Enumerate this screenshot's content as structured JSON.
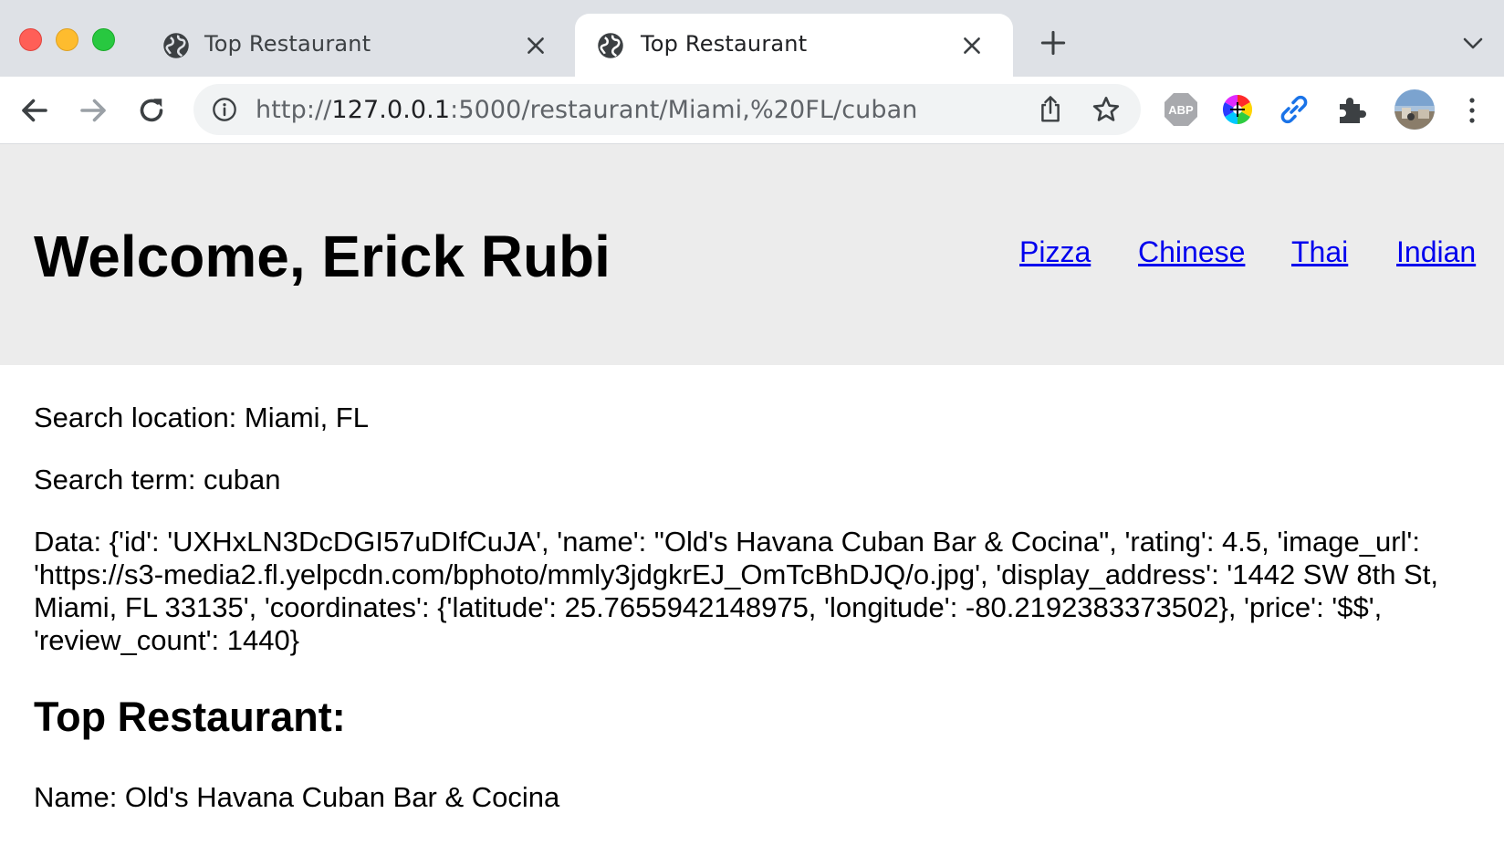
{
  "browser": {
    "tabs": [
      {
        "title": "Top Restaurant",
        "active": false
      },
      {
        "title": "Top Restaurant",
        "active": true
      }
    ],
    "url": {
      "scheme": "http://",
      "host": "127.0.0.1",
      "rest": ":5000/restaurant/Miami,%20FL/cuban"
    },
    "extensions": [
      "adblock-plus-icon",
      "color-picker-icon",
      "link-icon",
      "extensions-puzzle-icon"
    ],
    "adblock_label": "ABP"
  },
  "header": {
    "welcome": "Welcome, Erick Rubi",
    "nav": [
      "Pizza",
      "Chinese",
      "Thai",
      "Indian"
    ]
  },
  "main": {
    "search_location": "Search location: Miami, FL",
    "search_term": "Search term: cuban",
    "data": "Data: {'id': 'UXHxLN3DcDGI57uDIfCuJA', 'name': \"Old's Havana Cuban Bar & Cocina\", 'rating': 4.5, 'image_url': 'https://s3-media2.fl.yelpcdn.com/bphoto/mmly3jdgkrEJ_OmTcBhDJQ/o.jpg', 'display_address': '1442 SW 8th St, Miami, FL 33135', 'coordinates': {'latitude': 25.7655942148975, 'longitude': -80.2192383373502}, 'price': '$$', 'review_count': 1440}",
    "top_heading": "Top Restaurant:",
    "name_line": "Name: Old's Havana Cuban Bar & Cocina"
  },
  "colors": {
    "header_band": "#ececec",
    "link": "#0000ee",
    "tabstrip": "#dee1e6"
  }
}
